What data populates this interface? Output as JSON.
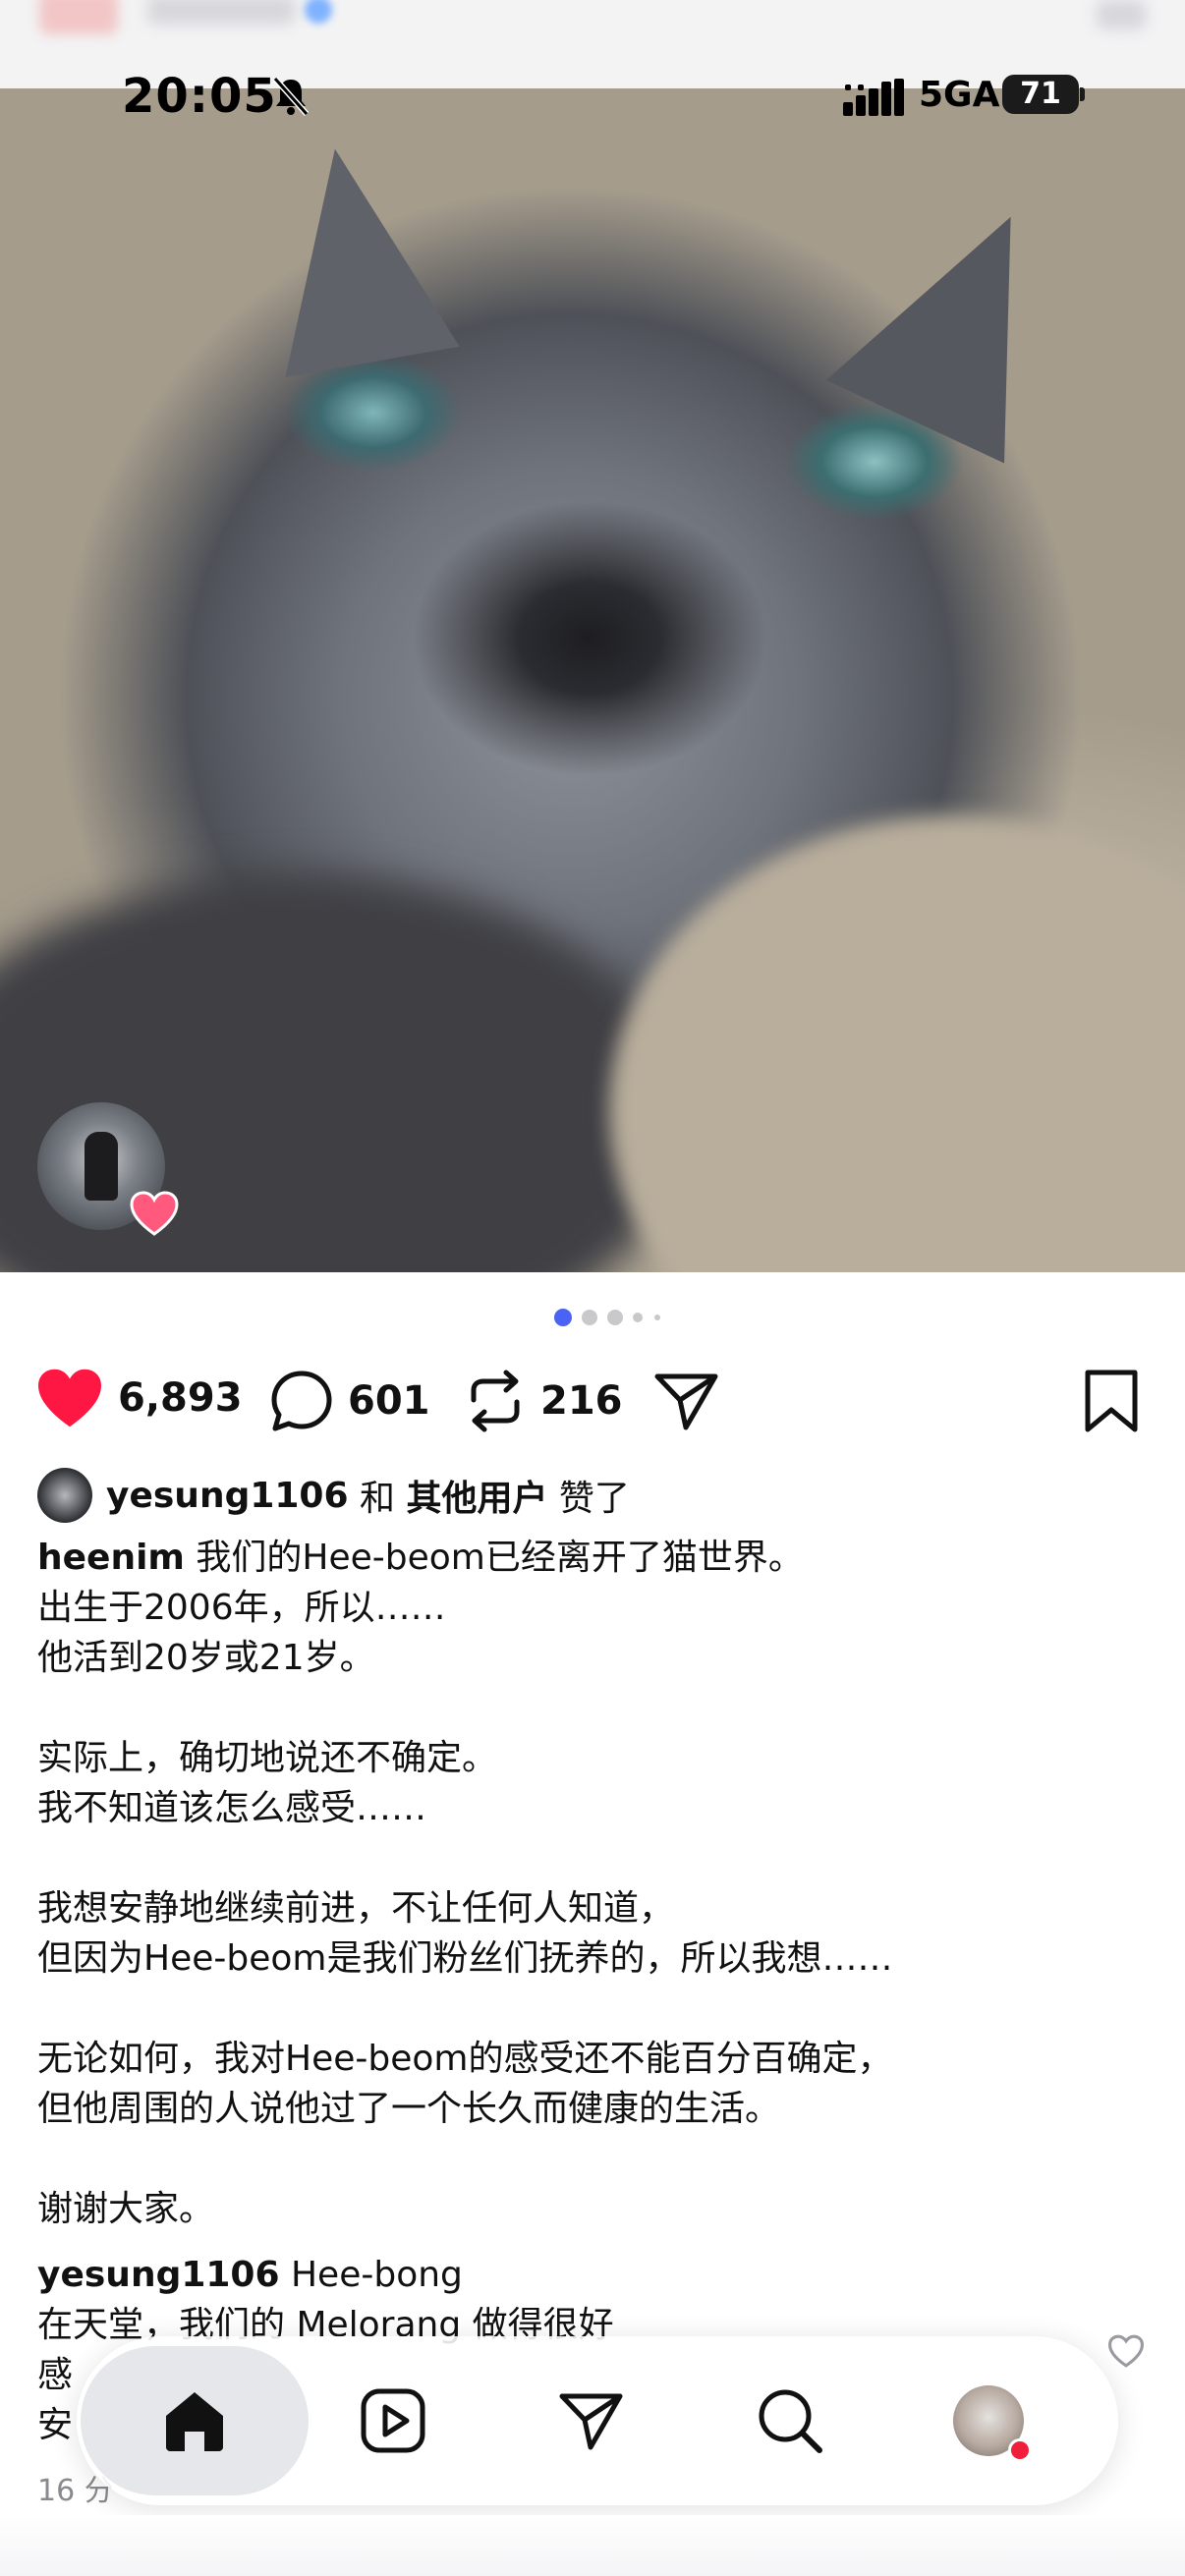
{
  "status_bar": {
    "time": "20:05",
    "network": "5GA",
    "battery": "71"
  },
  "post": {
    "likes": "6,893",
    "comments": "601",
    "reposts": "216",
    "liked_by": {
      "user": "yesung1106",
      "connector": " 和 ",
      "others": "其他用户",
      "suffix": " 赞了"
    },
    "caption": {
      "author": "heenim",
      "lines": [
        " 我们的Hee-beom已经离开了猫世界。",
        "出生于2006年，所以……",
        "他活到20岁或21岁。",
        "",
        "实际上，确切地说还不确定。",
        "我不知道该怎么感受……",
        "",
        "我想安静地继续前进，不让任何人知道，",
        "但因为Hee-beom是我们粉丝们抚养的，所以我想……",
        "",
        "无论如何，我对Hee-beom的感受还不能百分百确定，",
        "但他周围的人说他过了一个长久而健康的生活。",
        "",
        "谢谢大家。"
      ]
    },
    "comment": {
      "user": "yesung1106",
      "lines": [
        " Hee-bong",
        "在天堂，我们的 Melorang 做得很好",
        "感",
        "安"
      ]
    },
    "time_ago": "16 分"
  },
  "icons": {
    "like": "heart-filled-icon",
    "comment": "comment-bubble-icon",
    "repost": "repost-icon",
    "share": "paper-plane-icon",
    "save": "bookmark-icon"
  },
  "tabbar": [
    "home",
    "reels",
    "messages",
    "search",
    "profile"
  ],
  "colors": {
    "like": "#ff1744",
    "accent": "#4a63f5",
    "notification": "#f01d3b"
  }
}
